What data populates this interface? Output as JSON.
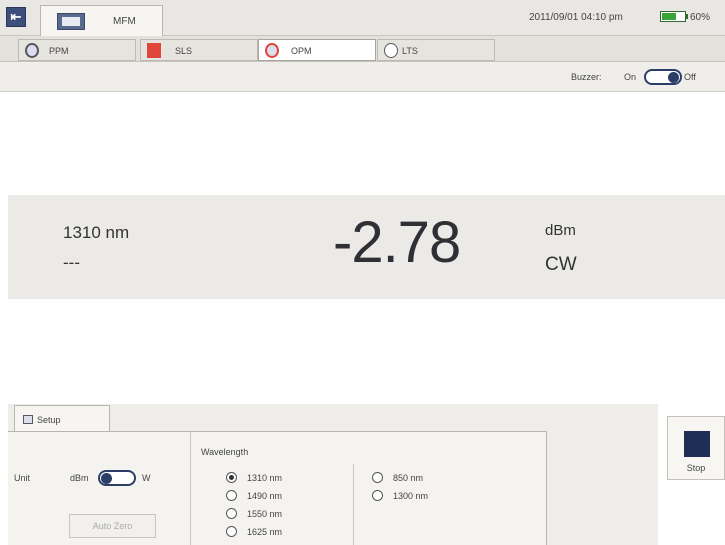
{
  "titlebar": {
    "app_tab_label": "MFM",
    "datetime": "2011/09/01 04:10 pm",
    "battery_percent": "60%",
    "battery_level": 0.6
  },
  "modules": [
    {
      "label": "PPM",
      "icon": "gear-icon",
      "active": false
    },
    {
      "label": "SLS",
      "icon": "light-source-icon",
      "active": false
    },
    {
      "label": "OPM",
      "icon": "power-meter-icon",
      "active": true
    },
    {
      "label": "LTS",
      "icon": "loss-test-icon",
      "active": false
    }
  ],
  "buzzer": {
    "label": "Buzzer:",
    "on_label": "On",
    "off_label": "Off",
    "state": "Off"
  },
  "reading": {
    "wavelength": "1310 nm",
    "reference": "---",
    "value": "-2.78",
    "unit": "dBm",
    "mode": "CW"
  },
  "setup": {
    "tab_label": "Setup",
    "unit_label": "Unit",
    "unit_dbm": "dBm",
    "unit_w": "W",
    "unit_state": "dBm",
    "auto_zero_label": "Auto Zero",
    "wavelength_label": "Wavelength",
    "wavelengths_left": [
      {
        "label": "1310 nm",
        "selected": true
      },
      {
        "label": "1490 nm",
        "selected": false
      },
      {
        "label": "1550 nm",
        "selected": false
      },
      {
        "label": "1625 nm",
        "selected": false
      }
    ],
    "wavelengths_right": [
      {
        "label": "850 nm",
        "selected": false
      },
      {
        "label": "1300 nm",
        "selected": false
      }
    ]
  },
  "stop_button": {
    "label": "Stop"
  },
  "colors": {
    "accent": "#2d3e66",
    "battery": "#3aa43a",
    "alert": "#e0463a"
  }
}
